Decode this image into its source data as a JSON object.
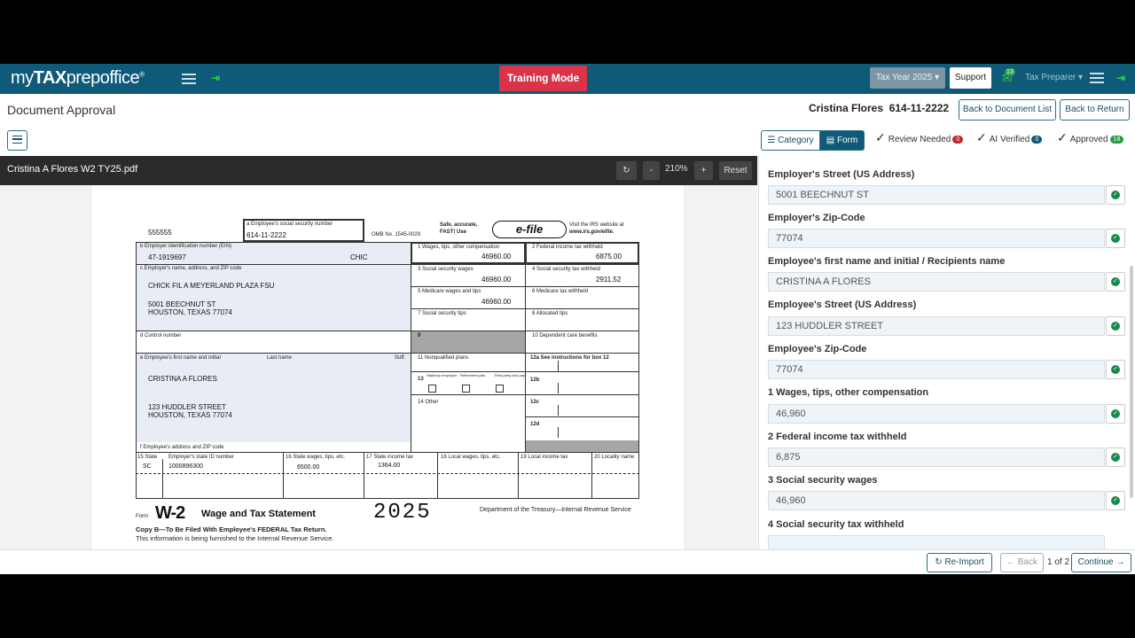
{
  "topbar": {
    "logo_prefix": "my",
    "logo_bold": "TAX",
    "logo_suffix": "prepoffice",
    "logo_reg": "®",
    "training_mode": "Training Mode",
    "tax_year": "Tax Year 2025",
    "support": "Support",
    "notification_count": "13",
    "role": "Tax Preparer"
  },
  "header": {
    "title": "Document Approval",
    "client_name": "Cristina Flores",
    "client_ssn": "614-11-2222",
    "back_to_list": "Back to Document List",
    "back_to_return": "Back to Return"
  },
  "filters": {
    "category": "Category",
    "form": "Form",
    "review_needed": "Review Needed",
    "review_count": "0",
    "ai_verified": "AI Verified",
    "ai_count": "0",
    "approved": "Approved",
    "approved_count": "18",
    "colors": {
      "review": "#c0262d",
      "ai": "#0e5a78",
      "approved": "#2a9a4a"
    }
  },
  "viewer": {
    "file_name": "Cristina A Flores W2 TY25.pdf",
    "zoom": "210%",
    "minus": "-",
    "plus": "+",
    "reset": "Reset"
  },
  "w2": {
    "control_top": "555555",
    "a_label": "a Employee's social security number",
    "ssn": "614-11-2222",
    "omb": "OMB No. 1545-0029",
    "safe": "Safe, accurate,",
    "fast": "FAST! Use",
    "efile": "e-file",
    "irs_visit": "Visit the IRS website at",
    "irs_url": "www.irs.gov/efile.",
    "b_label": "b Employer identification number (EIN)",
    "ein": "47-1919697",
    "chic": "CHIC",
    "c_label": "c Employer's name, address, and ZIP code",
    "employer_name": "CHICK FIL A MEYERLAND PLAZA FSU",
    "employer_street": "5001 BEECHNUT ST",
    "employer_city": "HOUSTON, TEXAS 77074",
    "d_label": "d Control number",
    "e_label": "e Employee's first name and initial",
    "last_name_label": "Last name",
    "suff_label": "Suff.",
    "employee_name": "CRISTINA  A  FLORES",
    "employee_street": "123 HUDDLER STREET",
    "employee_city": "HOUSTON, TEXAS 77074",
    "f_label": "f Employee's address and ZIP code",
    "box1_label": "1   Wages, tips, other compensation",
    "box1": "46960.00",
    "box2_label": "2   Federal income tax withheld",
    "box2": "6875.00",
    "box3_label": "3   Social security wages",
    "box3": "46960.00",
    "box4_label": "4   Social security tax withheld",
    "box4": "2911.52",
    "box5_label": "5   Medicare wages and tips",
    "box5": "46960.00",
    "box6_label": "6   Medicare tax withheld",
    "box7_label": "7   Social security tips",
    "box8_label": "8   Allocated tips",
    "box9_label": "9",
    "box10_label": "10  Dependent care benefits",
    "box11_label": "11  Nonqualified plans",
    "box12a_label": "12a See instructions for box 12",
    "box12b_label": "12b",
    "box12c_label": "12c",
    "box12d_label": "12d",
    "box13_label": "13",
    "statutory": "Statutory employee",
    "retirement": "Retirement plan",
    "thirdparty": "Third-party sick pay",
    "box14_label": "14  Other",
    "box15_label": "15  State",
    "state_id_label": "Employer's state ID number",
    "state": "SC",
    "state_id": "1000896300",
    "box16_label": "16  State wages, tips, etc.",
    "box16": "6500.00",
    "box17_label": "17  State income tax",
    "box17": "1364.00",
    "box18_label": "18  Local wages, tips, etc.",
    "box19_label": "19  Local income tax",
    "box20_label": "20  Locality name",
    "form_word": "Form",
    "form_name": "W-2",
    "form_title": "Wage and Tax Statement",
    "year": "2025",
    "dept": "Department of the Treasury—Internal Revenue Service",
    "copy_b": "Copy B—To Be Filed With Employee's FEDERAL Tax Return.",
    "copy_b_note": "This information is being furnished to the Internal Revenue Service."
  },
  "fields": [
    {
      "label": "Employer's Street (US Address)",
      "value": "5001 BEECHNUT ST"
    },
    {
      "label": "Employer's Zip-Code",
      "value": "77074"
    },
    {
      "label": "Employee's first name and initial / Recipients name",
      "value": "CRISTINA A FLORES"
    },
    {
      "label": "Employee's Street (US Address)",
      "value": "123 HUDDLER STREET"
    },
    {
      "label": "Employee's Zip-Code",
      "value": "77074"
    },
    {
      "label": "1 Wages, tips, other compensation",
      "value": "46,960"
    },
    {
      "label": "2 Federal income tax withheld",
      "value": "6,875"
    },
    {
      "label": "3 Social security wages",
      "value": "46,960"
    },
    {
      "label": "4 Social security tax withheld",
      "value": ""
    }
  ],
  "footer": {
    "reimport": "Re-Import",
    "back": "Back",
    "page": "1 of 2",
    "continue": "Continue"
  }
}
